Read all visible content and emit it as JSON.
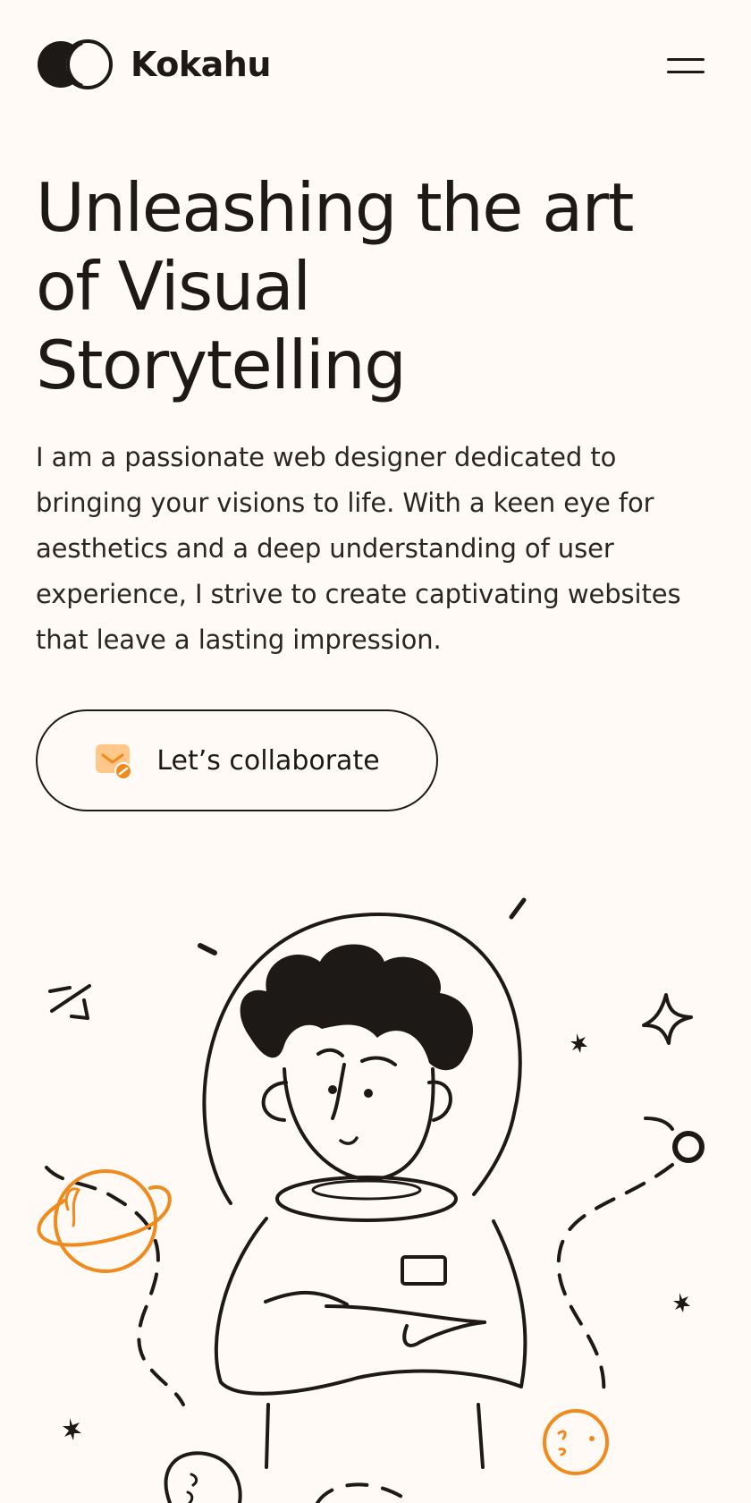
{
  "header": {
    "brand_name": "Kokahu",
    "logo_icon": "overlapping-circles-logo",
    "menu_icon": "hamburger-menu-icon"
  },
  "hero": {
    "title_lines": [
      "Unleashing the art",
      "of Visual",
      "Storytelling"
    ],
    "body_lines": [
      "I am a passionate web designer dedicated to",
      "bringing your visions to life. With a keen eye for",
      "aesthetics and a deep understanding of user",
      "experience, I strive to create captivating websites",
      "that leave a lasting impression."
    ]
  },
  "cta": {
    "label": "Let’s collaborate",
    "icon": "mail-check-icon"
  },
  "illustration": {
    "subject": "astronaut-illustration"
  },
  "colors": {
    "background": "#fffaf5",
    "text": "#1c1917",
    "accent": "#f08a1c",
    "accent_light": "#ffc78a"
  }
}
